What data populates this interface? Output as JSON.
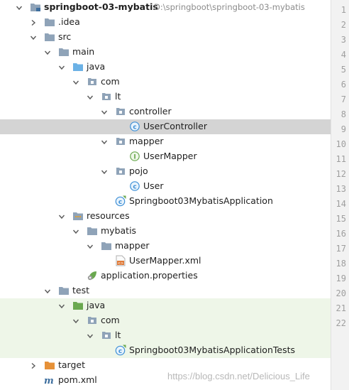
{
  "project_tree": {
    "items": [
      {
        "depth": 0,
        "expand": "down",
        "icon": "module-folder-icon",
        "name": "springboot-03-mybatis",
        "bold": true,
        "hint": "D:\\springboot\\springboot-03-mybatis",
        "bg": ""
      },
      {
        "depth": 1,
        "expand": "right",
        "icon": "folder-icon",
        "name": ".idea",
        "bold": false,
        "hint": "",
        "bg": ""
      },
      {
        "depth": 1,
        "expand": "down",
        "icon": "folder-icon",
        "name": "src",
        "bold": false,
        "hint": "",
        "bg": ""
      },
      {
        "depth": 2,
        "expand": "down",
        "icon": "folder-icon",
        "name": "main",
        "bold": false,
        "hint": "",
        "bg": ""
      },
      {
        "depth": 3,
        "expand": "down",
        "icon": "source-folder-icon",
        "name": "java",
        "bold": false,
        "hint": "",
        "bg": ""
      },
      {
        "depth": 4,
        "expand": "down",
        "icon": "package-icon",
        "name": "com",
        "bold": false,
        "hint": "",
        "bg": ""
      },
      {
        "depth": 5,
        "expand": "down",
        "icon": "package-icon",
        "name": "lt",
        "bold": false,
        "hint": "",
        "bg": ""
      },
      {
        "depth": 6,
        "expand": "down",
        "icon": "package-icon",
        "name": "controller",
        "bold": false,
        "hint": "",
        "bg": ""
      },
      {
        "depth": 7,
        "expand": "",
        "icon": "class-icon",
        "name": "UserController",
        "bold": false,
        "hint": "",
        "bg": "selected"
      },
      {
        "depth": 6,
        "expand": "down",
        "icon": "package-icon",
        "name": "mapper",
        "bold": false,
        "hint": "",
        "bg": ""
      },
      {
        "depth": 7,
        "expand": "",
        "icon": "interface-icon",
        "name": "UserMapper",
        "bold": false,
        "hint": "",
        "bg": ""
      },
      {
        "depth": 6,
        "expand": "down",
        "icon": "package-icon",
        "name": "pojo",
        "bold": false,
        "hint": "",
        "bg": ""
      },
      {
        "depth": 7,
        "expand": "",
        "icon": "class-icon",
        "name": "User",
        "bold": false,
        "hint": "",
        "bg": ""
      },
      {
        "depth": 6,
        "expand": "",
        "icon": "springboot-class-icon",
        "name": "Springboot03MybatisApplication",
        "bold": false,
        "hint": "",
        "bg": ""
      },
      {
        "depth": 3,
        "expand": "down",
        "icon": "resources-folder-icon",
        "name": "resources",
        "bold": false,
        "hint": "",
        "bg": ""
      },
      {
        "depth": 4,
        "expand": "down",
        "icon": "folder-icon",
        "name": "mybatis",
        "bold": false,
        "hint": "",
        "bg": ""
      },
      {
        "depth": 5,
        "expand": "down",
        "icon": "folder-icon",
        "name": "mapper",
        "bold": false,
        "hint": "",
        "bg": ""
      },
      {
        "depth": 6,
        "expand": "",
        "icon": "xml-file-icon",
        "name": "UserMapper.xml",
        "bold": false,
        "hint": "",
        "bg": ""
      },
      {
        "depth": 4,
        "expand": "",
        "icon": "properties-file-icon",
        "name": "application.properties",
        "bold": false,
        "hint": "",
        "bg": ""
      },
      {
        "depth": 2,
        "expand": "down",
        "icon": "folder-icon",
        "name": "test",
        "bold": false,
        "hint": "",
        "bg": ""
      },
      {
        "depth": 3,
        "expand": "down",
        "icon": "test-folder-icon",
        "name": "java",
        "bold": false,
        "hint": "",
        "bg": "test"
      },
      {
        "depth": 4,
        "expand": "down",
        "icon": "package-icon",
        "name": "com",
        "bold": false,
        "hint": "",
        "bg": "test"
      },
      {
        "depth": 5,
        "expand": "down",
        "icon": "package-icon",
        "name": "lt",
        "bold": false,
        "hint": "",
        "bg": "test"
      },
      {
        "depth": 6,
        "expand": "",
        "icon": "springboot-test-class-icon",
        "name": "Springboot03MybatisApplicationTests",
        "bold": false,
        "hint": "",
        "bg": "test"
      },
      {
        "depth": 1,
        "expand": "right",
        "icon": "excluded-folder-icon",
        "name": "target",
        "bold": false,
        "hint": "",
        "bg": ""
      },
      {
        "depth": 1,
        "expand": "",
        "icon": "maven-file-icon",
        "name": "pom.xml",
        "bold": false,
        "hint": "",
        "bg": ""
      }
    ]
  },
  "gutter": {
    "line_numbers": [
      "1",
      "2",
      "3",
      "4",
      "5",
      "6",
      "7",
      "8",
      "9",
      "10",
      "11",
      "12",
      "13",
      "14",
      "15",
      "16",
      "17",
      "18",
      "19",
      "20",
      "21",
      "22"
    ]
  },
  "watermark": "https://blog.csdn.net/Delicious_Life",
  "colors": {
    "selected_row": "#d4d4d4",
    "test_rows": "#eef6e8",
    "folder": "#8fa3b8",
    "source_folder": "#6cb2e6",
    "test_folder": "#6aa84f",
    "excluded_folder": "#e69138",
    "class_badge": "#3d8fd6",
    "interface_badge": "#6aa84f"
  }
}
